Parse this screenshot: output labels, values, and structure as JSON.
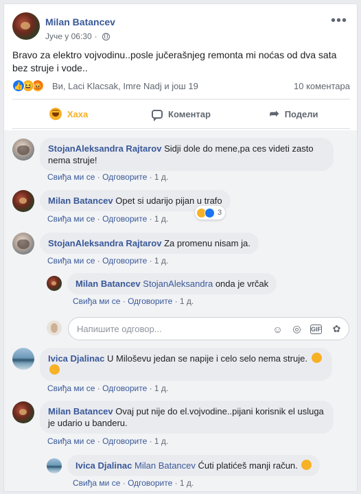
{
  "post": {
    "author": "Milan Batancev",
    "time": "Јуче у 06:30",
    "text": "Bravo za elektro vojvodinu..posle jučerašnjeg remonta mi noćas od dva sata bez struje i vode..",
    "reactions_text": "Ви, Laci Klacsak, Imre Nadj и још 19",
    "comments_count": "10 коментара"
  },
  "actions": {
    "haha": "Хаха",
    "comment": "Коментар",
    "share": "Подели"
  },
  "labels": {
    "like": "Свиђа ми се",
    "reply": "Одговорите",
    "sep": "·"
  },
  "comments": [
    {
      "author": "StojanAleksandra Rajtarov",
      "text": "Sidji dole do mene,pa ces videti zasto nema struje!",
      "time": "1 д."
    },
    {
      "author": "Milan Batancev",
      "text": "Opet si udarijo pijan u trafo",
      "time": "1 д.",
      "reaction_count": "3"
    },
    {
      "author": "StojanAleksandra Rajtarov",
      "text": "Za promenu nisam ja.",
      "time": "1 д.",
      "replies": [
        {
          "author": "Milan Batancev",
          "mention": "StojanAleksandra",
          "text": "onda je vrčak",
          "time": "1 д."
        }
      ]
    },
    {
      "author": "Ivica Djalinac",
      "text": "U Miloševu jedan se napije i celo selo nema struje.",
      "time": "1 д."
    },
    {
      "author": "Milan Batancev",
      "text": "Ovaj put nije do el.vojvodine..pijani korisnik el usluga je udario u banderu.",
      "time": "1 д.",
      "replies": [
        {
          "author": "Ivica Djalinac",
          "mention": "Milan Batancev",
          "text": "Ćuti platićeš manji račun.",
          "time": "1 д."
        }
      ]
    }
  ],
  "reply_input": {
    "placeholder": "Напишите одговор..."
  },
  "icons": [
    "more-icon",
    "globe-icon",
    "like-icon",
    "haha-icon",
    "angry-icon",
    "comment-icon",
    "share-icon",
    "emoji-icon",
    "camera-icon",
    "gif-icon",
    "sticker-icon"
  ],
  "colors": {
    "link": "#385898",
    "haha": "#f7b125",
    "like": "#1877f2",
    "muted": "#606770"
  }
}
